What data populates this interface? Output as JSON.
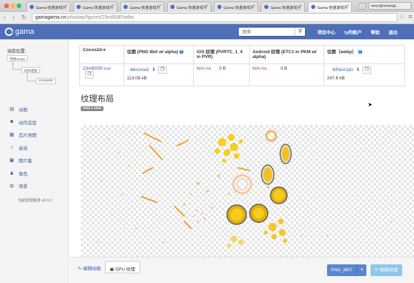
{
  "browser": {
    "tabs": [
      {
        "title": "Gama 快速游戏开"
      },
      {
        "title": "Gama 快速游戏开"
      },
      {
        "title": "Gama 快速游戏开"
      },
      {
        "title": "Gama 快速游戏开"
      },
      {
        "title": "Gama 快速游戏开"
      },
      {
        "title": "Gama 快速游戏开"
      },
      {
        "title": "Gama 快速游戏开"
      }
    ],
    "active_tab": 6,
    "user": "tanyi@smartgt...",
    "url_host": "gamagama.cn",
    "url_path": "/yi/wztap/figures/23m893R/atlas"
  },
  "nav": {
    "logo": "gama",
    "search_placeholder": "搜索",
    "links": [
      "项目中心",
      "ty的账户",
      "帮助",
      "退出"
    ]
  },
  "sidebar": {
    "location_title": "当前位置:",
    "breadcrumbs": [
      "项目wztap",
      "动作造型",
      "23m893R"
    ],
    "items": [
      {
        "label": "动画",
        "icon": "film-icon"
      },
      {
        "label": "动作造型",
        "icon": "users-icon"
      },
      {
        "label": "瓦片地图",
        "icon": "grid-icon"
      },
      {
        "label": "音效",
        "icon": "music-icon"
      },
      {
        "label": "图片集",
        "icon": "image-icon"
      },
      {
        "label": "角色",
        "icon": "person-icon"
      },
      {
        "label": "场景",
        "icon": "globe-icon"
      }
    ],
    "version": "当前呈现版本 v0.9.2"
  },
  "table": {
    "headers": [
      "Cocos2d-x",
      "位图 (PNG 8bit w/ alpha)",
      "iOS 纹理 (PVRTC_1_4 in PVR)",
      "Android 纹理 (ETC1 in PKM w/ alpha)",
      "位图（webp）"
    ],
    "cocos_file": "23mB93R.csx",
    "png_file": "48mcnw5",
    "png_size": "113.09 kB",
    "ios_na": "N/A",
    "ios_na_red": "n/a",
    "ios_size": "0 B",
    "android_na": "N/A",
    "android_na_red": "n/a",
    "android_size": "0 B",
    "webp_file": "BPbAUpG",
    "webp_size": "247.6 kB"
  },
  "section": {
    "title": "纹理布局",
    "dimensions": "1024 x 1024"
  },
  "bottom": {
    "edit_tab": "编辑动画",
    "gpu_tab": "GPU 纹理",
    "format_button": "PNG_8BIT",
    "refresh_button": "刷新纹理"
  }
}
